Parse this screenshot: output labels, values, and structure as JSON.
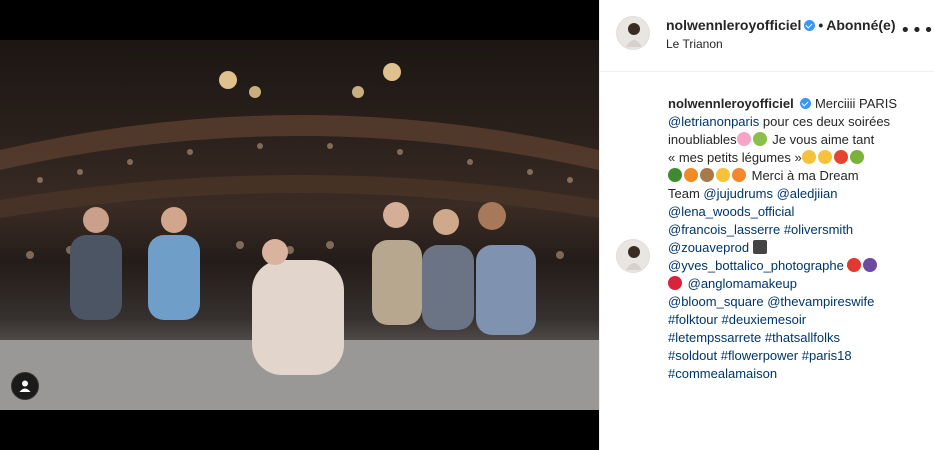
{
  "post": {
    "username": "nolwennleroyofficiel",
    "follow_status": "Abonné(e)",
    "location": "Le Trianon",
    "more_icon": "•••"
  },
  "caption": {
    "username": "nolwennleroyofficiel",
    "t1": "Merciiii PARIS",
    "m_trianon": "@letrianonparis",
    "t2": "pour ces deux soirées",
    "t3": "inoubliables",
    "t4": "Je vous aime tant",
    "t5": "« mes petits légumes »",
    "t6": "Merci à ma Dream",
    "t7": "Team",
    "m_juju": "@jujudrums",
    "m_aled": "@aledjiian",
    "m_lena": "@lena_woods_official",
    "m_francois": "@francois_lasserre",
    "h_oliver": "#oliversmith",
    "m_zouave": "@zouaveprod",
    "m_yves": "@yves_bottalico_photographe",
    "m_anglo": "@anglomamakeup",
    "m_bloom": "@bloom_square",
    "m_vampire": "@thevampireswife",
    "h_folk": "#folktour",
    "h_deux": "#deuxiemesoir",
    "h_temps": "#letempssarrete",
    "h_thats": "#thatsallfolks",
    "h_sold": "#soldout",
    "h_flower": "#flowerpower",
    "h_paris": "#paris18",
    "h_comme": "#commealamaison"
  },
  "colors": {
    "link": "#003569",
    "text": "#262626",
    "verified": "#3897f0",
    "border": "#efefef"
  },
  "icons": {
    "user_tag": "user-tag-icon",
    "verified": "verified-badge-icon",
    "more": "more-options-icon"
  }
}
